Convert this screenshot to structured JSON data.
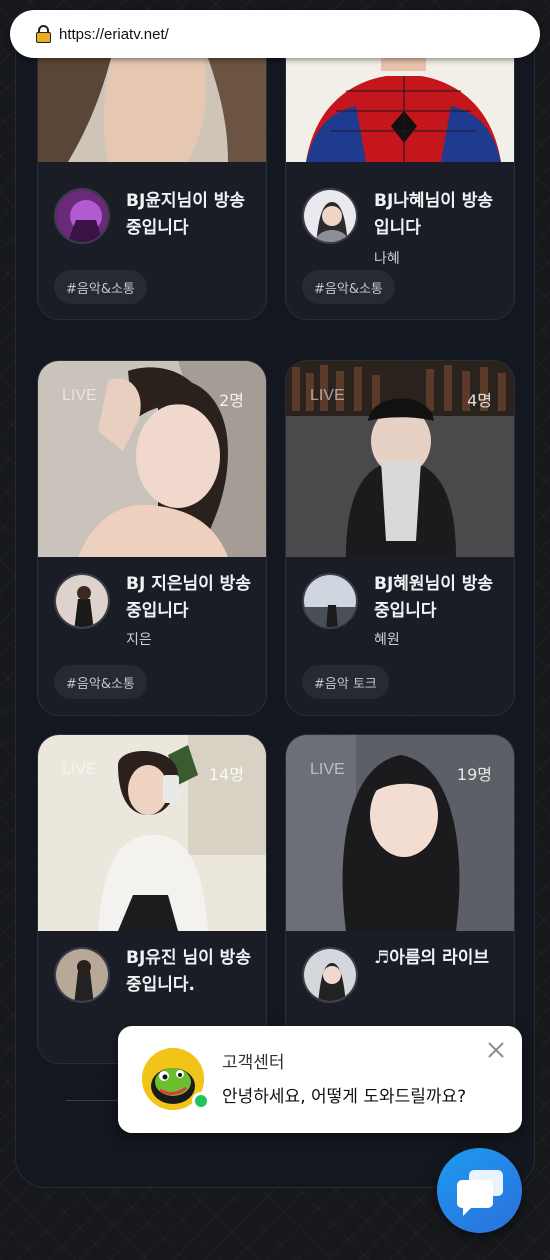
{
  "browser": {
    "url": "https://eriatv.net/"
  },
  "streams": [
    {
      "title": "BJ윤지님이 방송중입니다",
      "name": "",
      "live": "",
      "viewers": "",
      "tag": "#음악&소통"
    },
    {
      "title": "BJ나혜님이 방송 입니다",
      "name": "나혜",
      "live": "",
      "viewers": "",
      "tag": "#음악&소통"
    },
    {
      "title": "BJ 지은님이 방송중입니다",
      "name": "지은",
      "live": "LIVE",
      "viewers": "2명",
      "tag": "#음악&소통"
    },
    {
      "title": "BJ혜원님이 방송중입니다",
      "name": "혜원",
      "live": "LIVE",
      "viewers": "4명",
      "tag": "#음악 토크"
    },
    {
      "title": "BJ유진 님이 방송중입니다.",
      "name": "",
      "live": "LIVE",
      "viewers": "14명",
      "tag": ""
    },
    {
      "title": "♬아름의 라이브",
      "name": "",
      "live": "LIVE",
      "viewers": "19명",
      "tag": ""
    }
  ],
  "support": {
    "title": "고객센터",
    "message": "안녕하세요, 어떻게 도와드릴까요?"
  },
  "colors": {
    "background": "#17181c",
    "card": "#1a1d25",
    "fab": "#1d9bf0",
    "online": "#21c35a"
  }
}
